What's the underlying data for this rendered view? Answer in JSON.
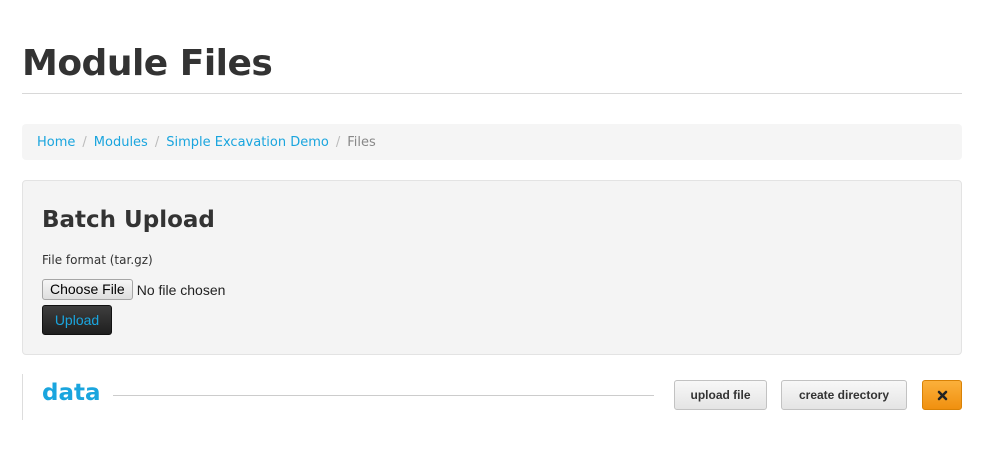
{
  "page": {
    "title": "Module Files"
  },
  "breadcrumb": {
    "items": [
      {
        "label": "Home"
      },
      {
        "label": "Modules"
      },
      {
        "label": "Simple Excavation Demo"
      }
    ],
    "separator": "/",
    "current": "Files"
  },
  "batch_upload": {
    "title": "Batch Upload",
    "file_label": "File format (tar.gz)",
    "choose_button": "Choose File",
    "no_file_text": "No file chosen",
    "upload_button": "Upload"
  },
  "directory": {
    "name": "data",
    "buttons": {
      "upload_file": "upload file",
      "create_directory": "create directory",
      "delete_icon": "close-icon"
    }
  },
  "colors": {
    "link": "#1aa5de",
    "warning": "#f39c12",
    "dark_button": "#2a2a2a"
  }
}
